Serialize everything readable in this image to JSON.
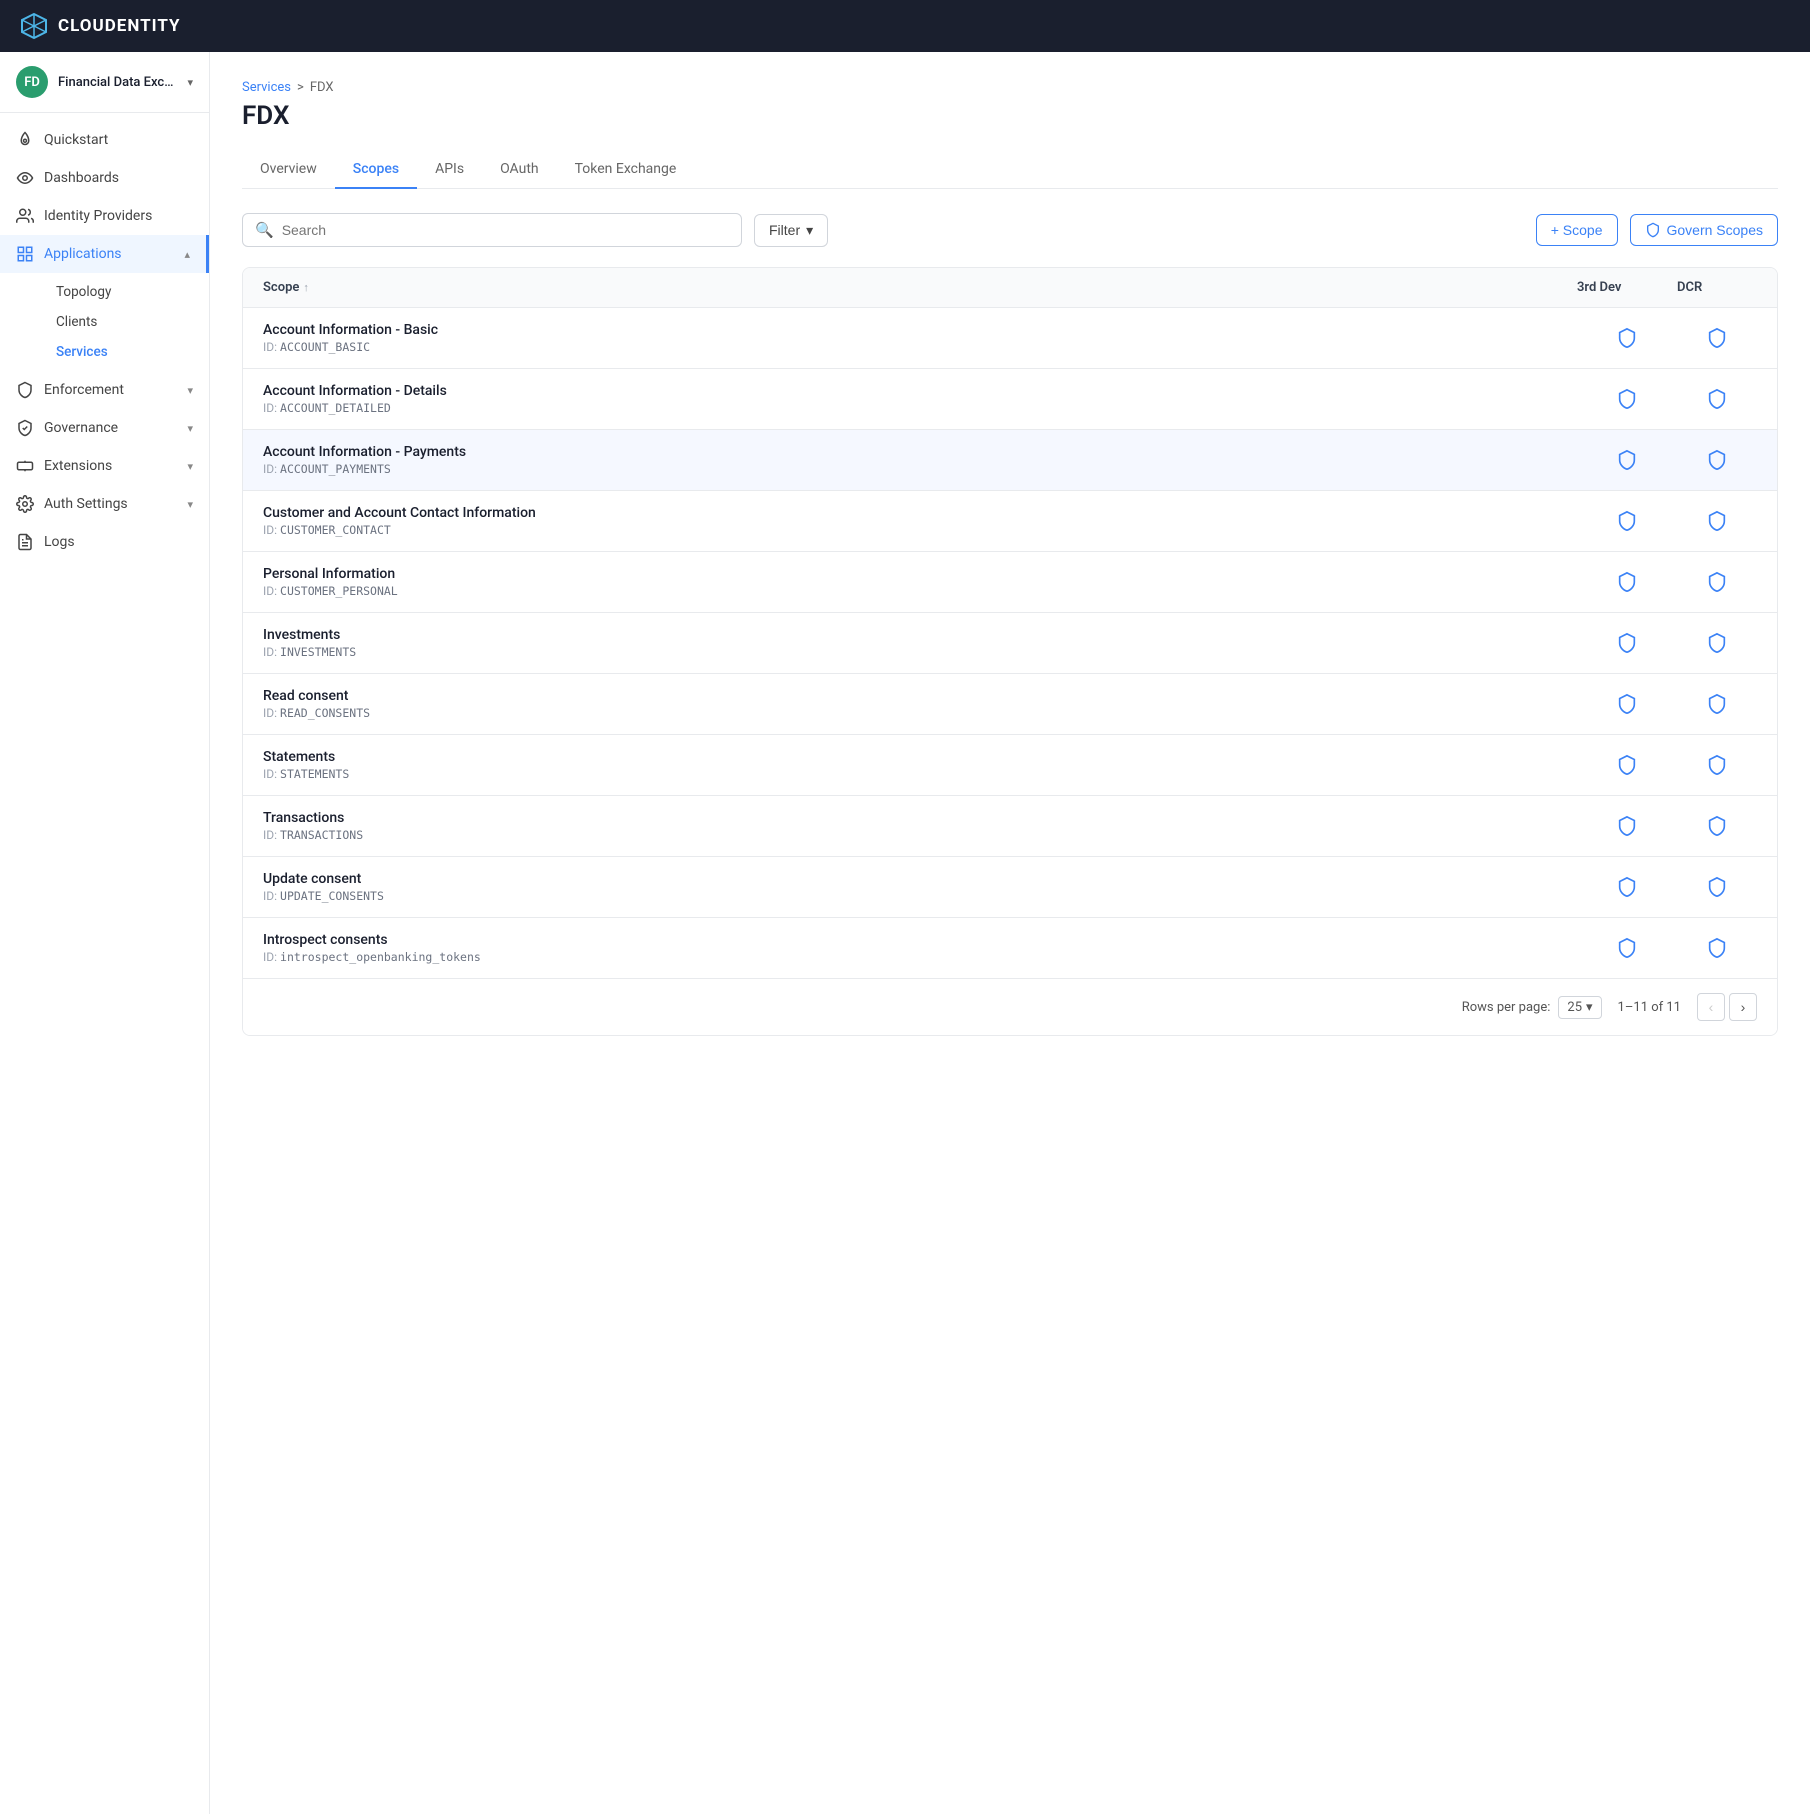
{
  "topnav": {
    "logo_text": "CLOUDENTITY",
    "logo_icon": "CI"
  },
  "sidebar": {
    "workspace": {
      "name": "Financial Data Excha...",
      "avatar_initials": "FD",
      "avatar_bg": "#2a9d6e"
    },
    "items": [
      {
        "id": "quickstart",
        "label": "Quickstart",
        "icon": "rocket",
        "active": false
      },
      {
        "id": "dashboards",
        "label": "Dashboards",
        "icon": "eye",
        "active": false
      },
      {
        "id": "identity-providers",
        "label": "Identity Providers",
        "icon": "users",
        "active": false
      },
      {
        "id": "applications",
        "label": "Applications",
        "icon": "grid",
        "active": true,
        "expanded": true
      },
      {
        "id": "enforcement",
        "label": "Enforcement",
        "icon": "shield",
        "active": false,
        "expandable": true
      },
      {
        "id": "governance",
        "label": "Governance",
        "icon": "shield-check",
        "active": false,
        "expandable": true
      },
      {
        "id": "extensions",
        "label": "Extensions",
        "icon": "puzzle",
        "active": false,
        "expandable": true
      },
      {
        "id": "auth-settings",
        "label": "Auth Settings",
        "icon": "settings",
        "active": false,
        "expandable": true
      },
      {
        "id": "logs",
        "label": "Logs",
        "icon": "file-text",
        "active": false
      }
    ],
    "sub_items": [
      {
        "id": "topology",
        "label": "Topology",
        "active": false
      },
      {
        "id": "clients",
        "label": "Clients",
        "active": false
      },
      {
        "id": "services",
        "label": "Services",
        "active": true
      }
    ]
  },
  "breadcrumb": {
    "parent": "Services",
    "separator": ">",
    "current": "FDX"
  },
  "page": {
    "title": "FDX"
  },
  "tabs": [
    {
      "id": "overview",
      "label": "Overview",
      "active": false
    },
    {
      "id": "scopes",
      "label": "Scopes",
      "active": true
    },
    {
      "id": "apis",
      "label": "APIs",
      "active": false
    },
    {
      "id": "oauth",
      "label": "OAuth",
      "active": false
    },
    {
      "id": "token-exchange",
      "label": "Token Exchange",
      "active": false
    }
  ],
  "toolbar": {
    "search_placeholder": "Search",
    "filter_label": "Filter",
    "add_scope_label": "+ Scope",
    "govern_scopes_label": "Govern Scopes"
  },
  "table": {
    "columns": [
      {
        "id": "scope",
        "label": "Scope",
        "sortable": true
      },
      {
        "id": "3rd-dev",
        "label": "3rd Dev",
        "sortable": false
      },
      {
        "id": "dcr",
        "label": "DCR",
        "sortable": false
      }
    ],
    "rows": [
      {
        "name": "Account Information - Basic",
        "id": "ACCOUNT_BASIC",
        "highlighted": false
      },
      {
        "name": "Account Information - Details",
        "id": "ACCOUNT_DETAILED",
        "highlighted": false
      },
      {
        "name": "Account Information - Payments",
        "id": "ACCOUNT_PAYMENTS",
        "highlighted": true
      },
      {
        "name": "Customer and Account Contact Information",
        "id": "CUSTOMER_CONTACT",
        "highlighted": false
      },
      {
        "name": "Personal Information",
        "id": "CUSTOMER_PERSONAL",
        "highlighted": false
      },
      {
        "name": "Investments",
        "id": "INVESTMENTS",
        "highlighted": false
      },
      {
        "name": "Read consent",
        "id": "READ_CONSENTS",
        "highlighted": false
      },
      {
        "name": "Statements",
        "id": "STATEMENTS",
        "highlighted": false
      },
      {
        "name": "Transactions",
        "id": "TRANSACTIONS",
        "highlighted": false
      },
      {
        "name": "Update consent",
        "id": "UPDATE_CONSENTS",
        "highlighted": false
      },
      {
        "name": "Introspect consents",
        "id": "introspect_openbanking_tokens",
        "highlighted": false
      }
    ]
  },
  "pagination": {
    "rows_per_page_label": "Rows per page:",
    "rows_per_page_value": "25",
    "page_info": "1–11 of 11"
  }
}
